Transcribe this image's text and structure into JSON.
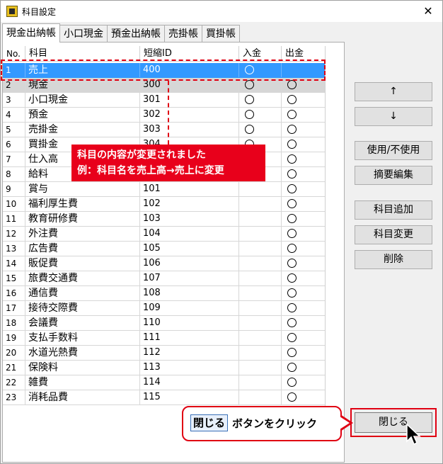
{
  "window": {
    "title": "科目設定",
    "close_glyph": "✕"
  },
  "tabs": [
    "現金出納帳",
    "小口現金",
    "預金出納帳",
    "売掛帳",
    "買掛帳"
  ],
  "table": {
    "headers": {
      "no": "No.",
      "name": "科目",
      "short": "短縮ID",
      "in": "入金",
      "out": "出金"
    },
    "rows": [
      {
        "no": "1",
        "name": "売上",
        "short": "400",
        "in": true,
        "out": false
      },
      {
        "no": "2",
        "name": "現金",
        "short": "300",
        "in": true,
        "out": true
      },
      {
        "no": "3",
        "name": "小口現金",
        "short": "301",
        "in": true,
        "out": true
      },
      {
        "no": "4",
        "name": "預金",
        "short": "302",
        "in": true,
        "out": true
      },
      {
        "no": "5",
        "name": "売掛金",
        "short": "303",
        "in": true,
        "out": true
      },
      {
        "no": "6",
        "name": "買掛金",
        "short": "304",
        "in": true,
        "out": true
      },
      {
        "no": "7",
        "name": "仕入高",
        "short": "",
        "in": false,
        "out": true
      },
      {
        "no": "8",
        "name": "給料",
        "short": "",
        "in": false,
        "out": true
      },
      {
        "no": "9",
        "name": "賞与",
        "short": "101",
        "in": false,
        "out": true
      },
      {
        "no": "10",
        "name": "福利厚生費",
        "short": "102",
        "in": false,
        "out": true
      },
      {
        "no": "11",
        "name": "教育研修費",
        "short": "103",
        "in": false,
        "out": true
      },
      {
        "no": "12",
        "name": "外注費",
        "short": "104",
        "in": false,
        "out": true
      },
      {
        "no": "13",
        "name": "広告費",
        "short": "105",
        "in": false,
        "out": true
      },
      {
        "no": "14",
        "name": "販促費",
        "short": "106",
        "in": false,
        "out": true
      },
      {
        "no": "15",
        "name": "旅費交通費",
        "short": "107",
        "in": false,
        "out": true
      },
      {
        "no": "16",
        "name": "通信費",
        "short": "108",
        "in": false,
        "out": true
      },
      {
        "no": "17",
        "name": "接待交際費",
        "short": "109",
        "in": false,
        "out": true
      },
      {
        "no": "18",
        "name": "会議費",
        "short": "110",
        "in": false,
        "out": true
      },
      {
        "no": "19",
        "name": "支払手数料",
        "short": "111",
        "in": false,
        "out": true
      },
      {
        "no": "20",
        "name": "水道光熱費",
        "short": "112",
        "in": false,
        "out": true
      },
      {
        "no": "21",
        "name": "保険料",
        "short": "113",
        "in": false,
        "out": true
      },
      {
        "no": "22",
        "name": "雑費",
        "short": "114",
        "in": false,
        "out": true
      },
      {
        "no": "23",
        "name": "消耗品費",
        "short": "115",
        "in": false,
        "out": true
      }
    ]
  },
  "buttons": {
    "up": "↑",
    "down": "↓",
    "toggle_use": "使用/不使用",
    "edit_summary": "摘要編集",
    "add_account": "科目追加",
    "change_account": "科目変更",
    "delete": "削除",
    "close": "閉じる"
  },
  "annotations": {
    "change_line1": "科目の内容が変更されました",
    "change_line2": "例：科目名を売上高→売上に変更",
    "bubble_button": "閉じる",
    "bubble_text": "ボタンをクリック"
  },
  "colors": {
    "selection": "#3399ff",
    "callout": "#e8001b"
  }
}
